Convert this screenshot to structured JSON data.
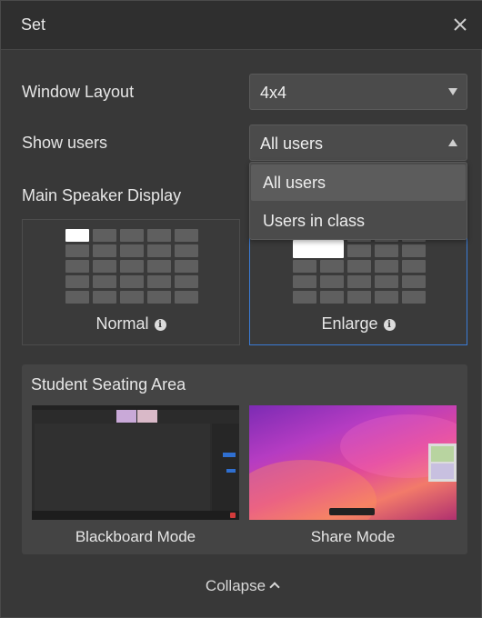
{
  "header": {
    "title": "Set"
  },
  "window_layout": {
    "label": "Window Layout",
    "value": "4x4"
  },
  "show_users": {
    "label": "Show users",
    "value": "All users",
    "options": [
      "All users",
      "Users in class"
    ]
  },
  "main_speaker": {
    "label": "Main Speaker Display",
    "normal_label": "Normal",
    "enlarge_label": "Enlarge"
  },
  "seating": {
    "title": "Student Seating Area",
    "blackboard_label": "Blackboard Mode",
    "share_label": "Share Mode"
  },
  "footer": {
    "collapse_label": "Collapse"
  },
  "colors": {
    "accent": "#3a7bd5",
    "panel": "#383838",
    "header": "#2f2f2f"
  },
  "icons": {
    "close": "close-icon",
    "info": "info-icon",
    "caret": "chevron-down-icon",
    "collapse": "chevron-up-icon"
  }
}
